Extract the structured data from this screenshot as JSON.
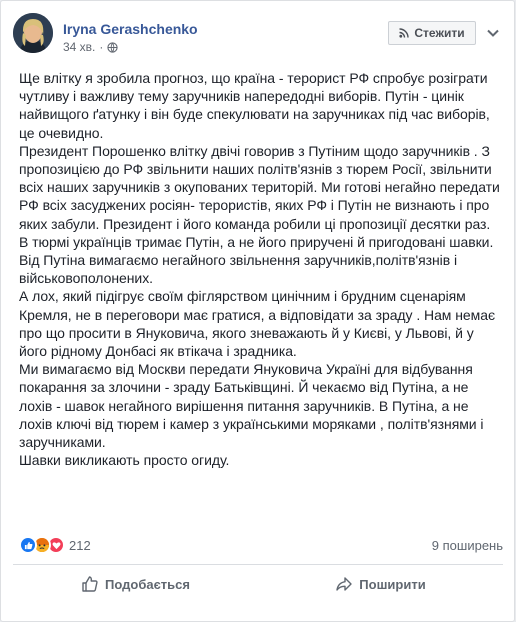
{
  "post": {
    "author": "Iryna Gerashchenko",
    "time": "34 хв.",
    "follow_label": "Стежити",
    "paragraphs": [
      "Ще влітку я зробила прогноз, що країна - терорист РФ спробує розіграти чутливу і важливу тему заручників напередодні виборів. Путін - цинік найвищого ґатунку і він буде спекулювати на заручниках під час виборів, це очевидно.",
      "Президент Порошенко влітку двічі говорив з Путіним щодо заручників . З пропозицією до РФ звільнити наших політв'язнів з тюрем Росії, звільнити всіх наших заручників з окупованих територій. Ми готові негайно передати РФ всіх засуджених росіян- терористів, яких РФ і Путін не визнають і про яких забули. Президент і його команда робили ці пропозиції десятки раз.",
      "В тюрмі українців тримає Путін, а не його приручені й пригодовані шавки.",
      "Від Путіна вимагаємо негайного звільнення заручників,політв'язнів і військовополонених.",
      "А лох, який підігрує своїм фіглярством цинічним і брудним сценаріям Кремля, не в переговори має гратися, а відповідати за зраду . Нам немає про що просити в Януковича, якого зневажають й у Києві, у Львові, й у його рідному Донбасі як втікача і зрадника.",
      "Ми вимагаємо від Москви передати Януковича Україні для відбування покарання за злочини - зраду Батьківщині. Й чекаємо від Путіна, а не лохів - шавок негайного вирішення питання заручників. В Путіна, а не лохів ключі від тюрем і камер з українськими моряками , політв'язнями і заручниками.",
      "Шавки викликають просто огиду."
    ],
    "reactions_count": "212",
    "shares": "9 поширень",
    "like_label": "Подобається",
    "share_label": "Поширити"
  },
  "colors": {
    "link": "#385898",
    "like_blue": "#1877f2",
    "angry_orange": "#f7b125",
    "love_red": "#f33e58"
  },
  "icons": [
    "avatar",
    "globe-icon",
    "rss-icon",
    "chevron-down-icon",
    "like-reaction-icon",
    "angry-reaction-icon",
    "love-reaction-icon",
    "thumb-up-icon",
    "share-arrow-icon"
  ]
}
